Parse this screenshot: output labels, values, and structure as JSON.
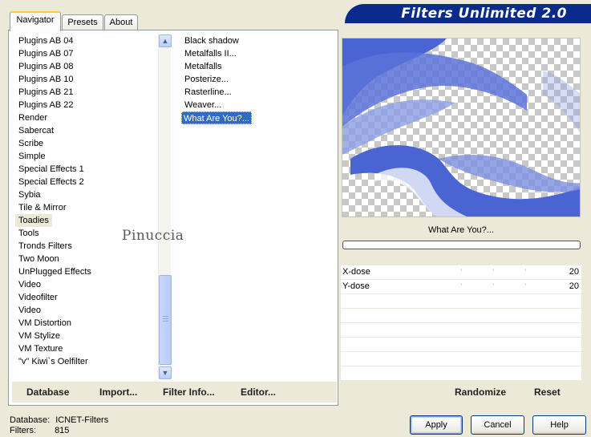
{
  "banner": {
    "title": "Filters Unlimited 2.0"
  },
  "tabs": [
    {
      "label": "Navigator",
      "active": true
    },
    {
      "label": "Presets",
      "active": false
    },
    {
      "label": "About",
      "active": false
    }
  ],
  "categories": {
    "items": [
      "Plugins AB 04",
      "Plugins AB 07",
      "Plugins AB 08",
      "Plugins AB 10",
      "Plugins AB 21",
      "Plugins AB 22",
      "Render",
      "Sabercat",
      "Scribe",
      "Simple",
      "Special Effects 1",
      "Special Effects 2",
      "Sybia",
      "Tile & Mirror",
      "Toadies",
      "Tools",
      "Tronds Filters",
      "Two Moon",
      "UnPlugged Effects",
      "Video",
      "Videofilter",
      "Video",
      "VM Distortion",
      "VM Stylize",
      "VM Texture",
      "\"v\" Kiwi`s Oelfilter"
    ],
    "selected": "Toadies"
  },
  "filters": {
    "items": [
      "Black shadow",
      "Metalfalls II...",
      "Metalfalls",
      "Posterize...",
      "Rasterline...",
      "Weaver...",
      "What Are You?..."
    ],
    "selected": "What Are You?..."
  },
  "watermark": "Pinuccia",
  "preview": {
    "filter_name": "What Are You?...",
    "accent_color": "#4a64d4"
  },
  "params": [
    {
      "label": "X-dose",
      "value": "20"
    },
    {
      "label": "Y-dose",
      "value": "20"
    },
    {
      "label": "",
      "value": ""
    },
    {
      "label": "",
      "value": ""
    },
    {
      "label": "",
      "value": ""
    },
    {
      "label": "",
      "value": ""
    },
    {
      "label": "",
      "value": ""
    },
    {
      "label": "",
      "value": ""
    }
  ],
  "left_buttons": {
    "database": "Database",
    "import": "Import...",
    "filter_info": "Filter Info...",
    "editor": "Editor..."
  },
  "right_buttons": {
    "randomize": "Randomize",
    "reset": "Reset"
  },
  "status": {
    "database_label": "Database:",
    "database_value": "ICNET-Filters",
    "filters_label": "Filters:",
    "filters_value": "815"
  },
  "dialog_buttons": {
    "apply": "Apply",
    "cancel": "Cancel",
    "help": "Help"
  }
}
